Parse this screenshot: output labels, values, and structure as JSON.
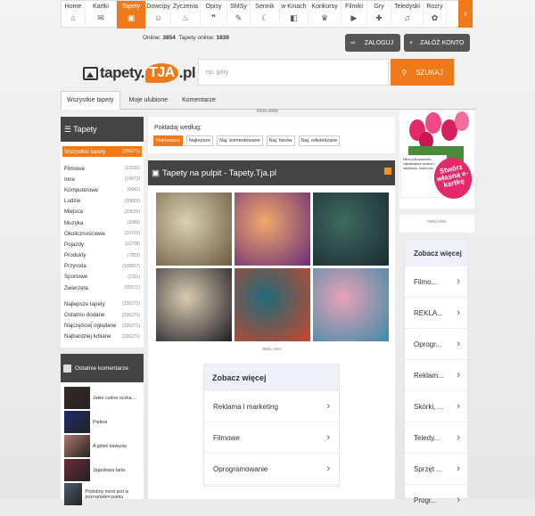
{
  "nav": {
    "items": [
      {
        "label": "Home",
        "icon": "home-icon",
        "glyph": "⌂"
      },
      {
        "label": "Kartki",
        "icon": "card-icon",
        "glyph": "✉"
      },
      {
        "label": "Tapety",
        "icon": "image-icon",
        "glyph": "▣"
      },
      {
        "label": "Dowcipy",
        "icon": "smile-icon",
        "glyph": "☺"
      },
      {
        "label": "Życzenia",
        "icon": "cake-icon",
        "glyph": "♨"
      },
      {
        "label": "Opisy",
        "icon": "quote-icon",
        "glyph": "❞"
      },
      {
        "label": "SMSy",
        "icon": "sms-icon",
        "glyph": "✎"
      },
      {
        "label": "Sennik",
        "icon": "moon-icon",
        "glyph": "☾"
      },
      {
        "label": "w Kinach",
        "icon": "film-icon",
        "glyph": "◧"
      },
      {
        "label": "Konkursy",
        "icon": "trophy-icon",
        "glyph": "♛"
      },
      {
        "label": "Filmiki",
        "icon": "play-icon",
        "glyph": "▶"
      },
      {
        "label": "Gry",
        "icon": "gamepad-icon",
        "glyph": "✚"
      },
      {
        "label": "Teledyski",
        "icon": "music-icon",
        "glyph": "♫"
      },
      {
        "label": "Rozry",
        "icon": "puzzle-icon",
        "glyph": "✿"
      }
    ],
    "next_glyph": "›"
  },
  "online": {
    "label": "Online:",
    "value": "3854",
    "tapety_label": "Tapety online:",
    "tapety_value": "1839"
  },
  "auth": {
    "login": "ZALOGUJ",
    "register": "ZAŁÓŻ KONTO",
    "login_glyph": "⇨",
    "register_glyph": "+"
  },
  "logo": {
    "pre": "tapety.",
    "mid": "TJA",
    "post": ".pl"
  },
  "search": {
    "placeholder": "np. góry",
    "button": "SZUKAJ",
    "glyph": "⚲"
  },
  "tabs": [
    {
      "label": "Wszystkie tapety",
      "active": true
    },
    {
      "label": "Moje ulubione",
      "active": false
    },
    {
      "label": "Komentarze",
      "active": false
    }
  ],
  "reklama": "REKLAMA",
  "reklama_mid": "REKLAMA",
  "sidebar": {
    "title": "Tapety",
    "title_glyph": "☰",
    "all": {
      "label": "Wszystkie tapety",
      "count": "(236271)"
    },
    "categories": [
      {
        "label": "Filmowe",
        "count": "(13330)"
      },
      {
        "label": "Inne",
        "count": "(19473)"
      },
      {
        "label": "Komputerowe",
        "count": "(6641)"
      },
      {
        "label": "Ludzie",
        "count": "(28603)"
      },
      {
        "label": "Miejsca",
        "count": "(33026)"
      },
      {
        "label": "Muzyka",
        "count": "(3986)"
      },
      {
        "label": "Okolicznościowe",
        "count": "(10716)"
      },
      {
        "label": "Pojazdy",
        "count": "(16728)"
      },
      {
        "label": "Produkty",
        "count": "(7853)"
      },
      {
        "label": "Przyroda",
        "count": "(108827)"
      },
      {
        "label": "Sportowe",
        "count": "(2111)"
      },
      {
        "label": "Zwierzęta",
        "count": "(35571)"
      }
    ],
    "sorts": [
      {
        "label": "Najlepsze tapety",
        "count": "(236271)"
      },
      {
        "label": "Ostatnio dodane",
        "count": "(236271)"
      },
      {
        "label": "Najczęściej oglądane",
        "count": "(236271)"
      },
      {
        "label": "Najbardziej lubiane",
        "count": "(236271)"
      }
    ]
  },
  "comments": {
    "title": "Ostatnie komentarze",
    "items": [
      {
        "text": "Jakie cudne oczka....",
        "color": "#3a2a22"
      },
      {
        "text": "Piękna",
        "color": "#1d2a6b"
      },
      {
        "text": "A gdzie kawusia",
        "color": "#b0776a"
      },
      {
        "text": "Jagodowa tarta",
        "color": "#6a2b3a"
      },
      {
        "text": "Podobny most jest w poznańskim parku",
        "color": "#4b5e6e"
      }
    ]
  },
  "sort": {
    "label": "Pokładaj według:",
    "options": [
      {
        "label": "Najnowsze",
        "active": true
      },
      {
        "label": "Najlepsze",
        "active": false
      },
      {
        "label": "Naj. komentowane",
        "active": false
      },
      {
        "label": "Naj. fanów",
        "active": false
      },
      {
        "label": "Naj. odwiedzane",
        "active": false
      }
    ]
  },
  "main": {
    "title": "Tapety na pulpit - Tapety.Tja.pl",
    "title_glyph": "▣"
  },
  "thumbs": [
    {
      "alt": "Fairy with white cat",
      "c1": "#d9d2b4",
      "c2": "#6b5a3a"
    },
    {
      "alt": "Lavender field sunset",
      "c1": "#f0a96a",
      "c2": "#6a2c78"
    },
    {
      "alt": "Woman lying on flowers",
      "c1": "#3d6b5e",
      "c2": "#1b2a30"
    },
    {
      "alt": "Retro couple portrait",
      "c1": "#d8cbb0",
      "c2": "#1d1d24"
    },
    {
      "alt": "Hummingbird and red flower",
      "c1": "#1f6b7a",
      "c2": "#c9472a"
    },
    {
      "alt": "Three women in dresses",
      "c1": "#e7a2b7",
      "c2": "#3c8aa8"
    }
  ],
  "see_more": {
    "title": "Zobacz więcej",
    "items": [
      "Reklama i marketing",
      "Filmowe",
      "Oprogramowanie"
    ]
  },
  "ad": {
    "card_text": "Miłość jest dawaniem, najważniejsze zaufanie i cierpliwość. Każdy zna...",
    "badge": "Stwórz własną e-kartkę"
  },
  "right_see_more": {
    "title": "Zobacz więcej",
    "items": [
      "Filmo...",
      "REKLA...",
      "Oprogr...",
      "Reklam...",
      "Skórki, ...",
      "Teledy...",
      "Sprzęt ...",
      "Progr..."
    ]
  },
  "chevron": "›"
}
